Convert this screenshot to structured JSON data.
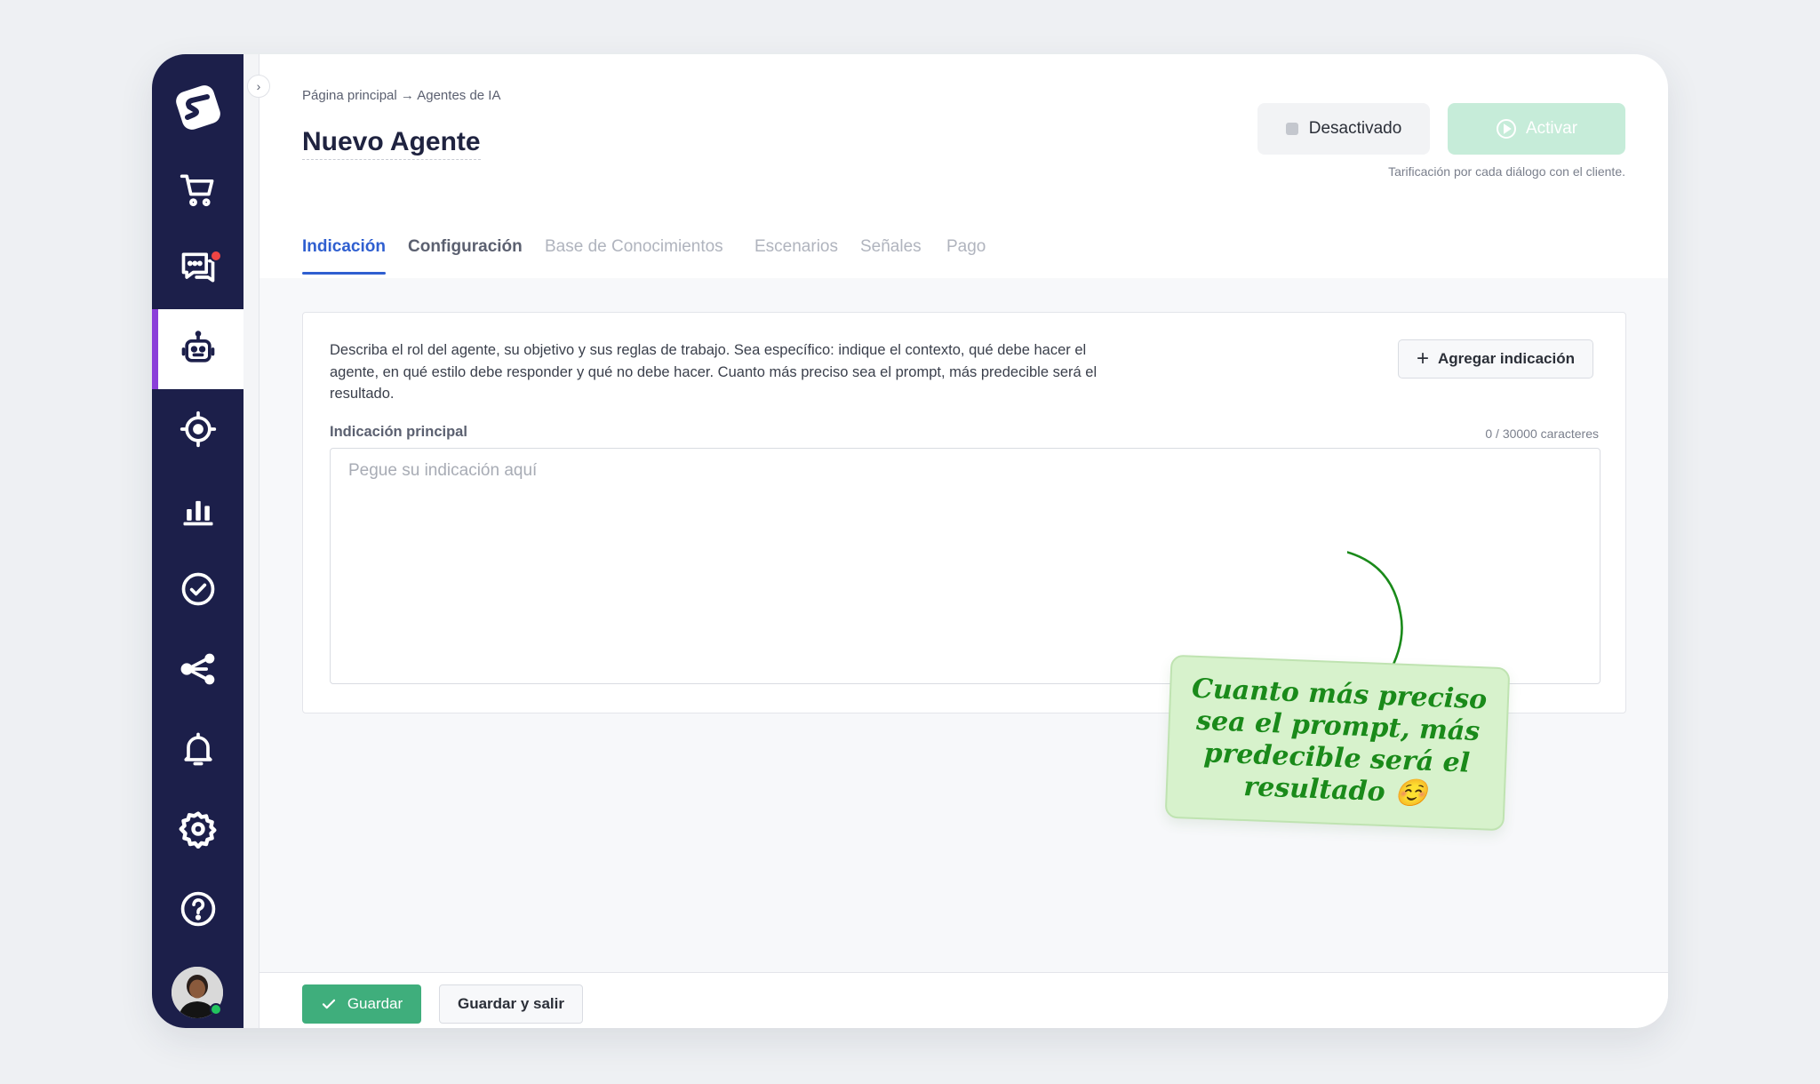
{
  "header": {
    "breadcrumb": "Página principal → Agentes de IA",
    "title": "Nuevo Agente",
    "status_label": "Desactivado",
    "activate_label": "Activar",
    "pricing_note": "Tarificación por cada diálogo con el cliente."
  },
  "tabs": [
    {
      "label": "Indicación",
      "state": "active"
    },
    {
      "label": "Configuración",
      "state": "enabled"
    },
    {
      "label": "Base de Conocimientos",
      "state": "disabled"
    },
    {
      "label": "Escenarios",
      "state": "disabled"
    },
    {
      "label": "Señales",
      "state": "disabled"
    },
    {
      "label": "Pago",
      "state": "disabled"
    }
  ],
  "prompt_card": {
    "description": "Describa el rol del agente, su objetivo y sus reglas de trabajo. Sea específico: indique el contexto, qué debe hacer el agente, en qué estilo debe responder y qué no debe hacer. Cuanto más preciso sea el prompt, más predecible será el resultado.",
    "add_button_label": "Agregar indicación",
    "field_label": "Indicación principal",
    "char_count": "0 / 30000 caracteres",
    "placeholder": "Pegue su indicación aquí",
    "value": ""
  },
  "sticky_note": {
    "text": "Cuanto más preciso sea el prompt, más predecible será el resultado ☺️",
    "color": "#1a8a1a"
  },
  "footer": {
    "save_label": "Guardar",
    "save_exit_label": "Guardar y salir"
  },
  "sidebar": {
    "items": [
      {
        "icon": "cart-icon"
      },
      {
        "icon": "chat-icon",
        "badge": true
      },
      {
        "icon": "robot-icon",
        "active": true
      },
      {
        "icon": "target-icon"
      },
      {
        "icon": "bar-chart-icon"
      },
      {
        "icon": "check-circle-icon"
      },
      {
        "icon": "share-icon"
      },
      {
        "icon": "bell-icon"
      },
      {
        "icon": "gear-icon"
      },
      {
        "icon": "help-icon"
      }
    ],
    "avatar_status": "online"
  },
  "colors": {
    "sidebar_bg": "#1c1f4a",
    "active_accent": "#8b3fd9",
    "tab_active": "#2f5fd0",
    "save_green": "#3fae7c",
    "activate_disabled": "#c6ecd9"
  }
}
